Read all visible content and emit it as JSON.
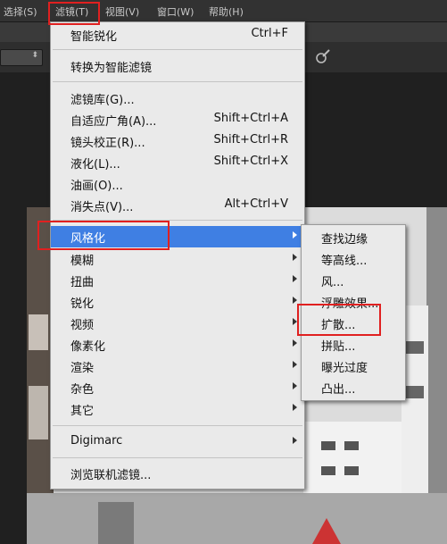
{
  "menubar": {
    "items": [
      {
        "label": "选择(S)"
      },
      {
        "label": "滤镜(T)"
      },
      {
        "label": "视图(V)"
      },
      {
        "label": "窗口(W)"
      },
      {
        "label": "帮助(H)"
      }
    ]
  },
  "filter_menu": {
    "items": [
      {
        "label": "智能锐化",
        "shortcut": "Ctrl+F"
      },
      {
        "label": "转换为智能滤镜"
      },
      {
        "label": "滤镜库(G)..."
      },
      {
        "label": "自适应广角(A)...",
        "shortcut": "Shift+Ctrl+A"
      },
      {
        "label": "镜头校正(R)...",
        "shortcut": "Shift+Ctrl+R"
      },
      {
        "label": "液化(L)...",
        "shortcut": "Shift+Ctrl+X"
      },
      {
        "label": "油画(O)..."
      },
      {
        "label": "消失点(V)...",
        "shortcut": "Alt+Ctrl+V"
      },
      {
        "label": "风格化"
      },
      {
        "label": "模糊"
      },
      {
        "label": "扭曲"
      },
      {
        "label": "锐化"
      },
      {
        "label": "视频"
      },
      {
        "label": "像素化"
      },
      {
        "label": "渲染"
      },
      {
        "label": "杂色"
      },
      {
        "label": "其它"
      },
      {
        "label": "Digimarc"
      },
      {
        "label": "浏览联机滤镜..."
      }
    ]
  },
  "stylize_submenu": {
    "items": [
      {
        "label": "查找边缘"
      },
      {
        "label": "等高线..."
      },
      {
        "label": "风..."
      },
      {
        "label": "浮雕效果..."
      },
      {
        "label": "扩散..."
      },
      {
        "label": "拼贴..."
      },
      {
        "label": "曝光过度"
      },
      {
        "label": "凸出..."
      }
    ]
  },
  "colors": {
    "highlight": "#3f7fe3",
    "annotation_red": "#e02020"
  }
}
